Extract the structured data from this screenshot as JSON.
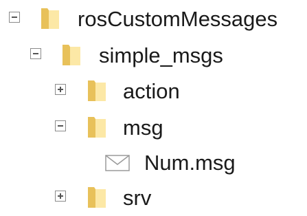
{
  "tree": {
    "root": {
      "label": "rosCustomMessages",
      "expanded": true,
      "icon": "folder-icon"
    },
    "package": {
      "label": "simple_msgs",
      "expanded": true,
      "icon": "folder-icon"
    },
    "children": [
      {
        "label": "action",
        "expanded": false,
        "icon": "folder-icon"
      },
      {
        "label": "msg",
        "expanded": true,
        "icon": "folder-icon"
      },
      {
        "label": "Num.msg",
        "icon": "envelope-file-icon"
      },
      {
        "label": "srv",
        "expanded": false,
        "icon": "folder-icon"
      }
    ]
  },
  "colors": {
    "folder_light": "#FCE8A6",
    "folder_dark": "#E8C15A",
    "toggle_border": "#8A8A8A",
    "text": "#1A1A1A"
  }
}
